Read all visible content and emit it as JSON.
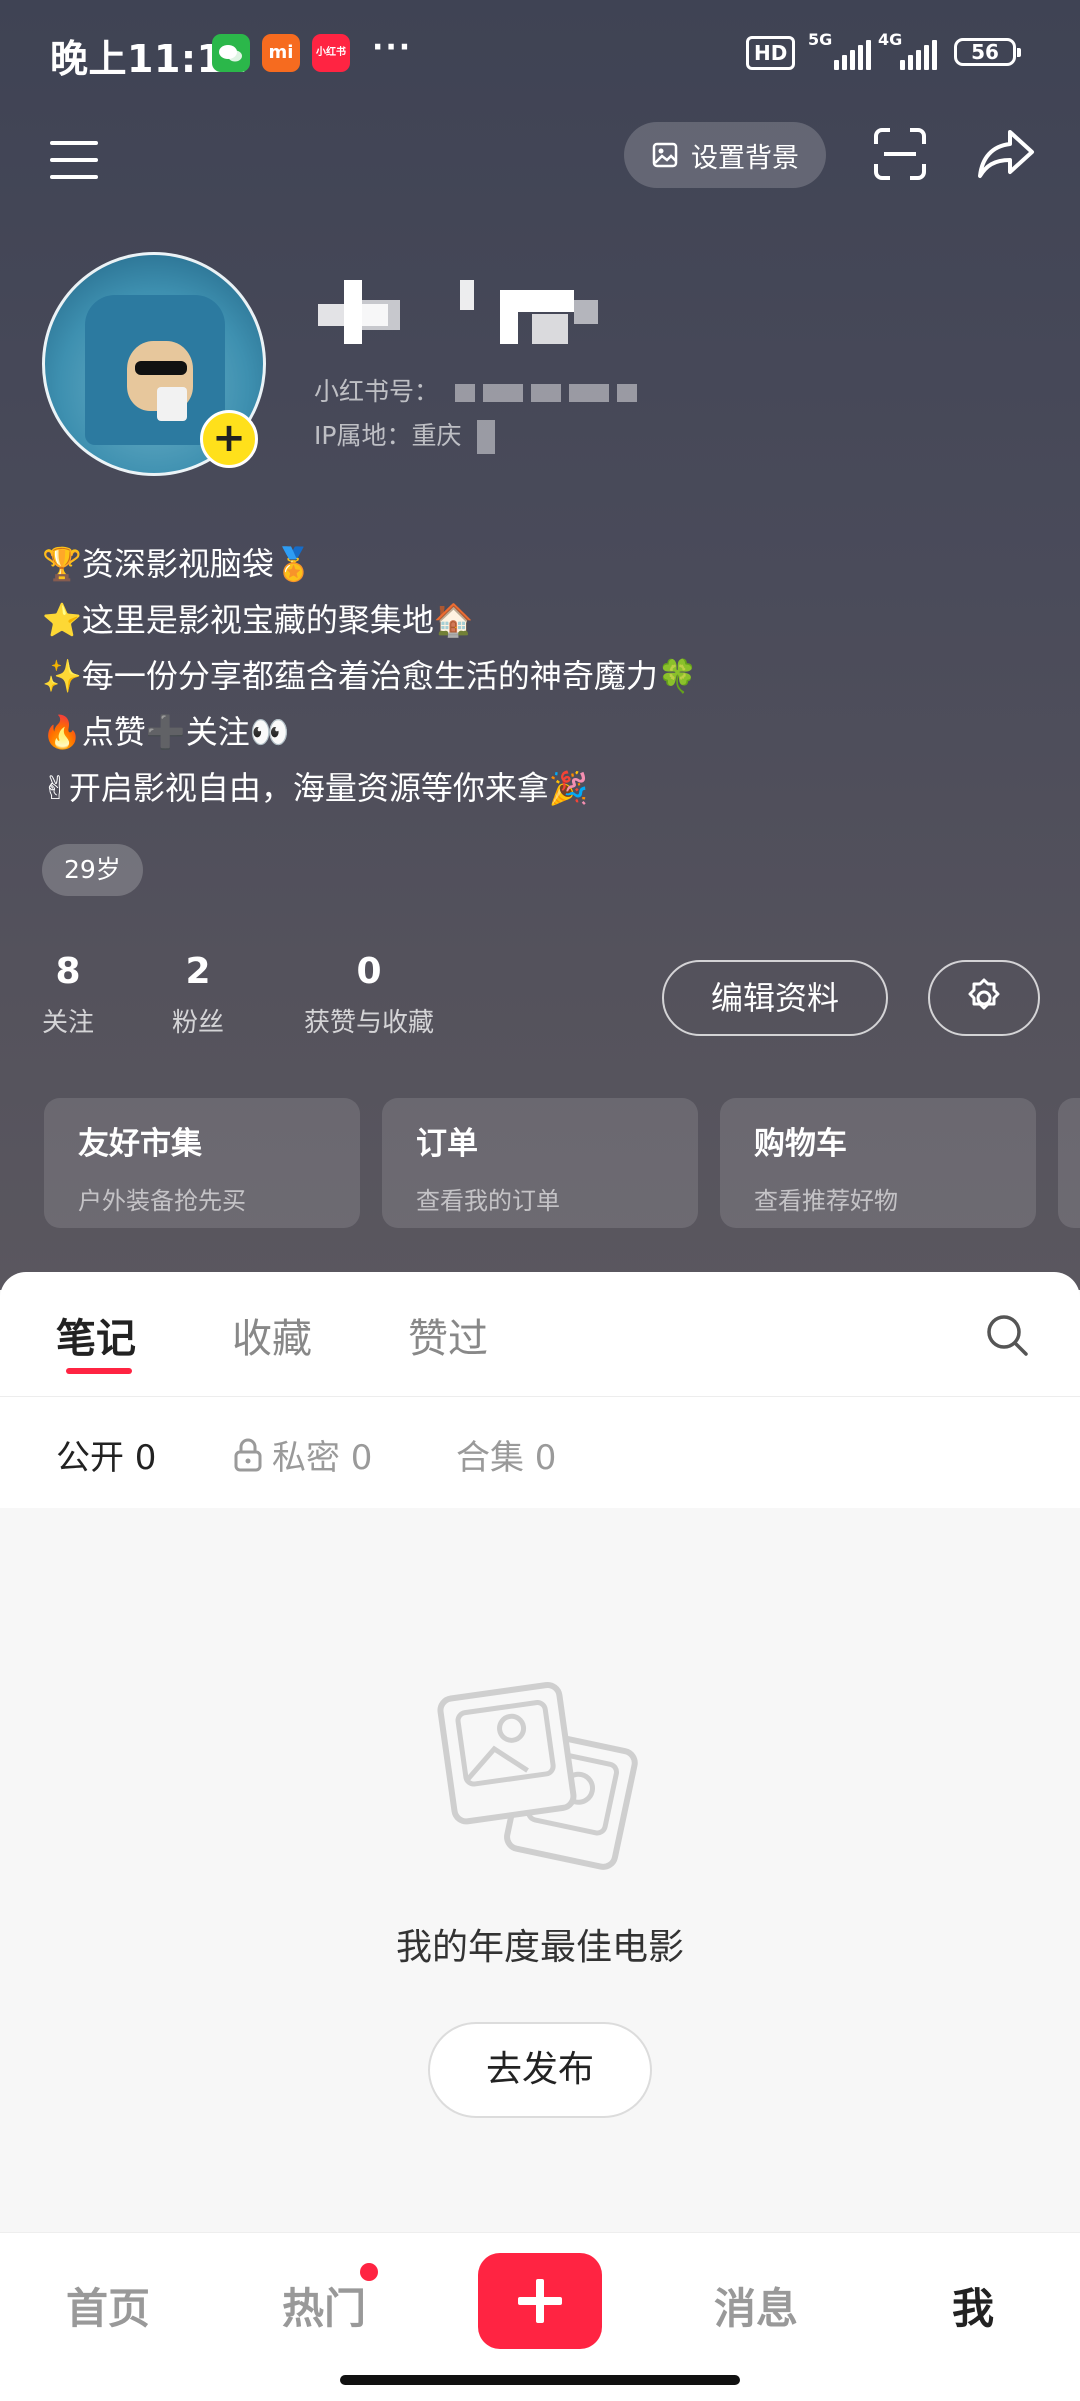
{
  "status_bar": {
    "time": "晚上11:14",
    "more": "···",
    "hd": "HD",
    "net1": "5G",
    "net2": "4G",
    "battery": "56",
    "mi_label": "mi",
    "xhs_label": "小红书"
  },
  "header": {
    "set_background_label": "设置背景"
  },
  "profile": {
    "id_label": "小红书号：",
    "ip_label": "IP属地：重庆",
    "bio": [
      "🏆资深影视脑袋🏅",
      "⭐这里是影视宝藏的聚集地🏠",
      "✨每一份分享都蕴含着治愈生活的神奇魔力🍀",
      "🔥点赞➕关注👀",
      "✌开启影视自由，海量资源等你来拿🎉"
    ],
    "age_tag": "29岁"
  },
  "stats": [
    {
      "value": "8",
      "label": "关注"
    },
    {
      "value": "2",
      "label": "粉丝"
    },
    {
      "value": "0",
      "label": "获赞与收藏"
    }
  ],
  "actions": {
    "edit_profile": "编辑资料"
  },
  "cards": [
    {
      "title": "友好市集",
      "subtitle": "户外装备抢先买"
    },
    {
      "title": "订单",
      "subtitle": "查看我的订单"
    },
    {
      "title": "购物车",
      "subtitle": "查看推荐好物"
    }
  ],
  "tabs": [
    "笔记",
    "收藏",
    "赞过"
  ],
  "subtabs": [
    "公开 0",
    "私密 0",
    "合集 0"
  ],
  "empty": {
    "text": "我的年度最佳电影",
    "button": "去发布"
  },
  "bottom_nav": [
    "首页",
    "热门",
    "消息",
    "我"
  ],
  "colors": {
    "accent": "#ff2442",
    "avatar_badge": "#ffe01b"
  }
}
